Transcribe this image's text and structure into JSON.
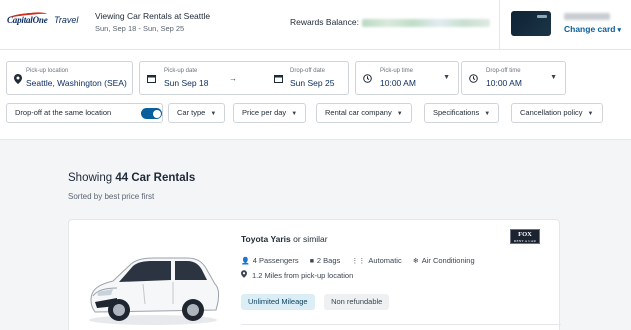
{
  "header": {
    "logo_capital": "CapitalOne",
    "logo_travel": "Travel",
    "trip_title": "Viewing Car Rentals at Seattle",
    "trip_dates": "Sun, Sep 18 - Sun, Sep 25",
    "rewards_label": "Rewards Balance:",
    "change_card_label": "Change card",
    "icons": {
      "change_card": "chevron-down-icon"
    }
  },
  "search": {
    "pickup_location": {
      "label": "Pick-up location",
      "value": "Seattle, Washington (SEA)",
      "icon": "location-pin-icon"
    },
    "pickup_date": {
      "label": "Pick-up date",
      "value": "Sun Sep 18",
      "icon": "calendar-icon"
    },
    "dropoff_date": {
      "label": "Drop-off date",
      "value": "Sun Sep 25",
      "icon": "calendar-icon"
    },
    "pickup_time": {
      "label": "Pick-up time",
      "value": "10:00 AM",
      "icon": "clock-icon"
    },
    "dropoff_time": {
      "label": "Drop-off time",
      "value": "10:00 AM",
      "icon": "clock-icon"
    },
    "same_location_label": "Drop-off at the same location",
    "same_location_on": true,
    "filters": [
      "Car type",
      "Price per day",
      "Rental car company",
      "Specifications",
      "Cancellation policy"
    ]
  },
  "results": {
    "showing_prefix": "Showing",
    "count_label": "44 Car Rentals",
    "sorted_label": "Sorted by best price first",
    "items": [
      {
        "name": "Toyota Yaris",
        "name_suffix": "or similar",
        "vendor_logo": "FOX",
        "vendor_sub": "RENT A CAR",
        "specs": [
          {
            "icon": "passenger-icon",
            "label": "4 Passengers"
          },
          {
            "icon": "bag-icon",
            "label": "2 Bags"
          },
          {
            "icon": "transmission-icon",
            "label": "Automatic"
          },
          {
            "icon": "snowflake-icon",
            "label": "Air Conditioning"
          }
        ],
        "distance": "1.2 Miles from pick-up location",
        "badges": [
          "Unlimited Mileage",
          "Non refundable"
        ]
      }
    ]
  },
  "colors": {
    "accent": "#0b5e9c",
    "brand_red": "#d22e1e",
    "brand_navy": "#0b2c5f",
    "badge_bg": "#dbeef6"
  }
}
